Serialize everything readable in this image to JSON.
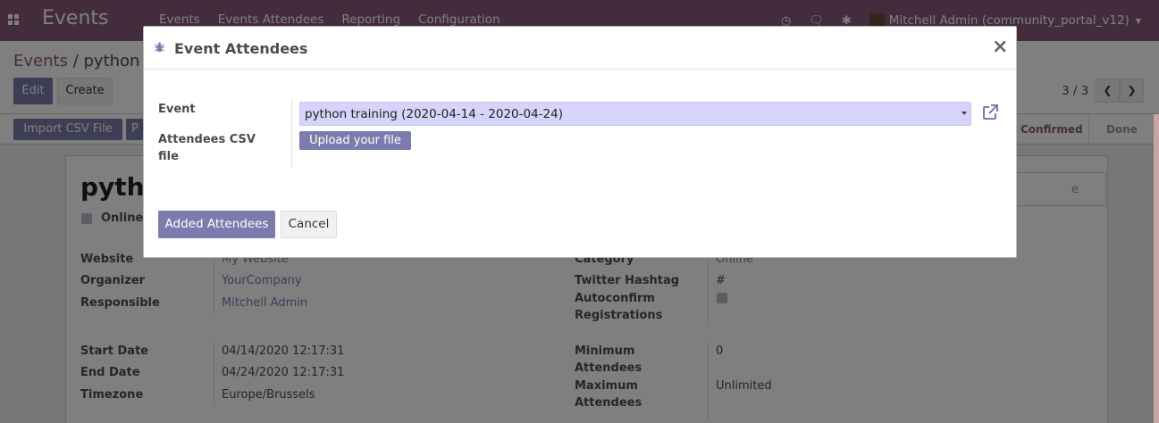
{
  "navbar": {
    "brand": "Events",
    "menu": [
      "Events",
      "Events Attendees",
      "Reporting",
      "Configuration"
    ],
    "user": "Mitchell Admin (community_portal_v12)"
  },
  "control": {
    "breadcrumb_parent": "Events",
    "breadcrumb_sep": "/",
    "breadcrumb_current": "python",
    "edit_label": "Edit",
    "create_label": "Create",
    "pager": "3 / 3"
  },
  "statusbar": {
    "import_label": "Import CSV File",
    "p_label": "P",
    "stage_confirmed": "Confirmed",
    "stage_done": "Done"
  },
  "sheet": {
    "title": "pytho",
    "online_label": "Online",
    "right_box_text": "e",
    "left_fields": [
      {
        "label": "Website",
        "value": "My Website"
      },
      {
        "label": "Organizer",
        "value": "YourCompany"
      },
      {
        "label": "Responsible",
        "value": "Mitchell Admin"
      },
      {
        "label": "Start Date",
        "value": "04/14/2020 12:17:31"
      },
      {
        "label": "End Date",
        "value": "04/24/2020 12:17:31"
      },
      {
        "label": "Timezone",
        "value": "Europe/Brussels"
      }
    ],
    "right_fields": [
      {
        "label": "Category",
        "value": "Online"
      },
      {
        "label": "Twitter Hashtag",
        "value": "#"
      },
      {
        "label": "Autoconfirm Registrations",
        "value": ""
      },
      {
        "label": "Minimum Attendees",
        "value": "0"
      },
      {
        "label": "Maximum Attendees",
        "value": "Unlimited"
      }
    ]
  },
  "modal": {
    "title": "Event Attendees",
    "event_label": "Event",
    "event_value": "python training (2020-04-14 - 2020-04-24)",
    "csv_label": "Attendees CSV file",
    "upload_label": "Upload your file",
    "added_label": "Added Attendees",
    "cancel_label": "Cancel"
  },
  "colors": {
    "brand": "#875a7b",
    "primary_button": "#7c7bad",
    "select_highlight": "#d6d4fa"
  },
  "icons": [
    "apps-icon",
    "clock-icon",
    "chat-icon",
    "bug-icon",
    "close-icon",
    "external-link-icon",
    "chevron-left-icon",
    "chevron-right-icon"
  ]
}
